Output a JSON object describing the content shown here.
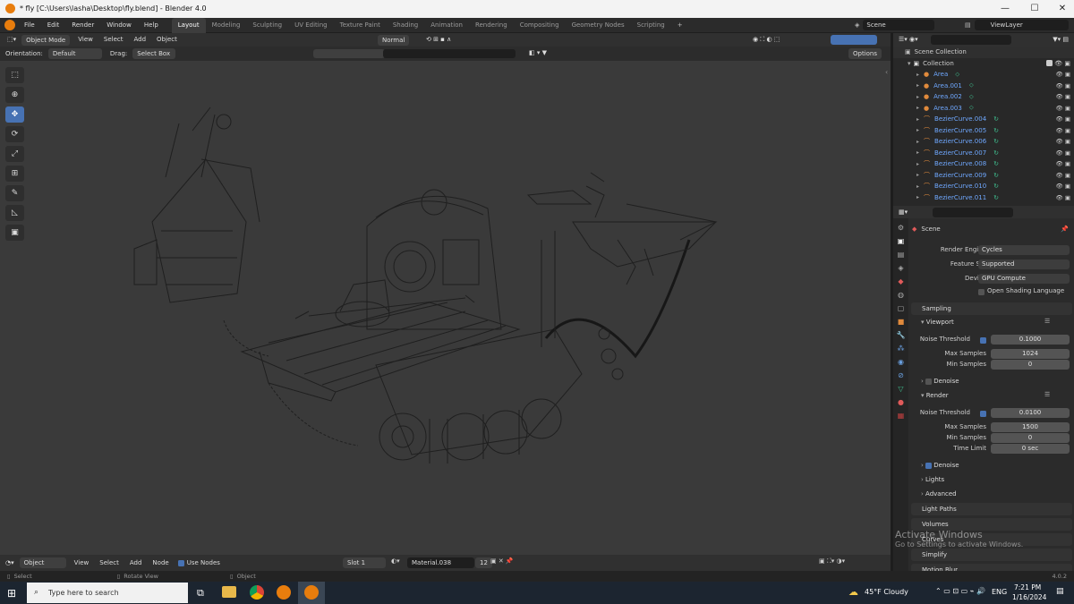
{
  "window": {
    "title": "* fly [C:\\Users\\lasha\\Desktop\\fly.blend] - Blender 4.0",
    "controls": [
      "—",
      "☐",
      "✕"
    ]
  },
  "menu": [
    "File",
    "Edit",
    "Render",
    "Window",
    "Help"
  ],
  "workspace_tabs": [
    "Layout",
    "Modeling",
    "Sculpting",
    "UV Editing",
    "Texture Paint",
    "Shading",
    "Animation",
    "Rendering",
    "Compositing",
    "Geometry Nodes",
    "Scripting"
  ],
  "active_workspace": "Layout",
  "scene_name": "Scene",
  "view_layer": "ViewLayer",
  "viewport_header": {
    "mode": "Object Mode",
    "menus": [
      "View",
      "Select",
      "Add",
      "Object"
    ],
    "pivot": "Normal",
    "orientation_label": "Orientation:",
    "orientation": "Default",
    "drag_label": "Drag:",
    "drag": "Select Box",
    "options": "Options"
  },
  "outliner": {
    "root": "Scene Collection",
    "collection": "Collection",
    "items": [
      {
        "name": "Area",
        "kind": "light"
      },
      {
        "name": "Area.001",
        "kind": "light"
      },
      {
        "name": "Area.002",
        "kind": "light"
      },
      {
        "name": "Area.003",
        "kind": "light"
      },
      {
        "name": "BezierCurve.004",
        "kind": "curve"
      },
      {
        "name": "BezierCurve.005",
        "kind": "curve"
      },
      {
        "name": "BezierCurve.006",
        "kind": "curve"
      },
      {
        "name": "BezierCurve.007",
        "kind": "curve"
      },
      {
        "name": "BezierCurve.008",
        "kind": "curve"
      },
      {
        "name": "BezierCurve.009",
        "kind": "curve"
      },
      {
        "name": "BezierCurve.010",
        "kind": "curve"
      },
      {
        "name": "BezierCurve.011",
        "kind": "curve"
      }
    ]
  },
  "properties": {
    "context": "Scene",
    "render_engine_label": "Render Engine",
    "render_engine": "Cycles",
    "feature_set_label": "Feature Set",
    "feature_set": "Supported",
    "device_label": "Device",
    "device": "GPU Compute",
    "osl_label": "Open Shading Language",
    "sampling": "Sampling",
    "viewport": "Viewport",
    "noise_threshold_label": "Noise Threshold",
    "vp_noise_threshold": "0.1000",
    "max_samples_label": "Max Samples",
    "vp_max_samples": "1024",
    "min_samples_label": "Min Samples",
    "vp_min_samples": "0",
    "denoise_label": "Denoise",
    "render": "Render",
    "r_noise_threshold": "0.0100",
    "r_max_samples": "1500",
    "r_min_samples": "0",
    "time_limit_label": "Time Limit",
    "r_time_limit": "0 sec",
    "lights": "Lights",
    "advanced": "Advanced",
    "light_paths": "Light Paths",
    "volumes": "Volumes",
    "curves": "Curves",
    "simplify": "Simplify",
    "motion_blur": "Motion Blur"
  },
  "node_header": {
    "mode": "Object",
    "menus": [
      "View",
      "Select",
      "Add",
      "Node"
    ],
    "use_nodes": "Use Nodes",
    "slot": "Slot 1",
    "material": "Material.038",
    "users": "12"
  },
  "status_bar": {
    "select": "Select",
    "rotate_view": "Rotate View",
    "object": "Object",
    "version": "4.0.2"
  },
  "watermark": {
    "title": "Activate Windows",
    "subtitle": "Go to Settings to activate Windows."
  },
  "taskbar": {
    "search_placeholder": "Type here to search",
    "weather": "45°F  Cloudy",
    "lang": "ENG",
    "time": "7:21 PM",
    "date": "1/16/2024"
  },
  "colors": {
    "accent": "#4772b3",
    "viewport_bg": "#3a3a3a",
    "light_icon": "#e08a3c",
    "curve_icon": "#3fbf8f"
  }
}
